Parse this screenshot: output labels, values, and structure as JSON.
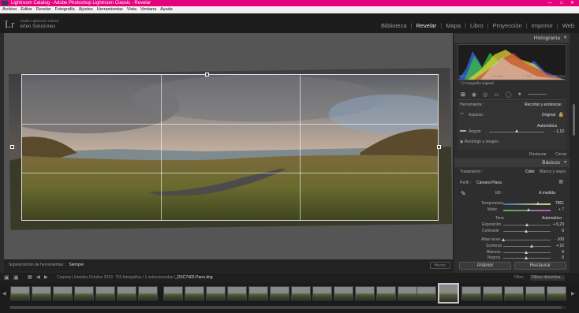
{
  "window": {
    "title": "Lightroom Catalog - Adobe Photoshop Lightroom Classic - Revelar",
    "controls": [
      "—",
      "□",
      "✕"
    ]
  },
  "menu": [
    "Archivo",
    "Editar",
    "Revelar",
    "Fotografía",
    "Ajustes",
    "Herramientas",
    "Vista",
    "Ventana",
    "Ayuda"
  ],
  "header": {
    "logo": "Lr",
    "identity_small": "Adobe Lightroom Classic",
    "identity": "Arteo Soluciones",
    "modules": [
      "Biblioteca",
      "Revelar",
      "Mapa",
      "Libro",
      "Proyección",
      "Imprimir",
      "Web"
    ],
    "active_module": "Revelar"
  },
  "toolbar": {
    "overlay_label": "Superposición de herramientas :",
    "overlay_value": "Siempre",
    "done": "Hecho"
  },
  "histogram": {
    "title": "Histograma",
    "left_val": "ISO 100",
    "mid1": "14 mm",
    "mid2": "f / 8,0",
    "right_val": "1/60 seg",
    "original_photo": "Fotografía original"
  },
  "crop_panel": {
    "tool_label": "Herramienta :",
    "tool_value": "Recortar y enderezar",
    "aspect": "Aspecto :",
    "aspect_value": "Original",
    "auto": "Automática",
    "angle": "Ángulo",
    "angle_value": "- 1,10",
    "constrain": "Restringir a imagen",
    "reset": "Restaurar",
    "close": "Cerrar"
  },
  "basic": {
    "title": "Básicos",
    "treatment_label": "Tratamiento :",
    "treatment_color": "Color",
    "treatment_bw": "Blanco y negro",
    "profile_label": "Perfil :",
    "profile_value": "Cámara Plana",
    "wb_label": "EB :",
    "wb_value": "A medida",
    "temp_label": "Temperatura",
    "temp_value": "7961",
    "tint_label": "Matiz",
    "tint_value": "+ 7",
    "tone_label": "Tono",
    "tone_auto": "Automático",
    "exposure_label": "Exposición",
    "exposure_value": "+ 0,23",
    "contrast_label": "Contraste",
    "contrast_value": "0",
    "highlights_label": "Altas luces",
    "highlights_value": "- 100",
    "shadows_label": "Sombras",
    "shadows_value": "+ 22",
    "whites_label": "Blancos",
    "whites_value": "0",
    "blacks_label": "Negros",
    "blacks_value": "0"
  },
  "buttons": {
    "previous": "Anterior",
    "reset": "Restaurar"
  },
  "filmbar": {
    "source": "Carpeta | Islandia Octubre 2019",
    "count": "726 fotografías / 1 seleccionadas /",
    "file": "_DSC7402-Pano.dng",
    "filter_label": "Filtro:",
    "filter_value": "Filtros desactiva..."
  },
  "colors": {
    "title_bar": "#e6007e",
    "panel_bg": "#2e2e2e",
    "accent_selected": "#c8c8c8"
  }
}
